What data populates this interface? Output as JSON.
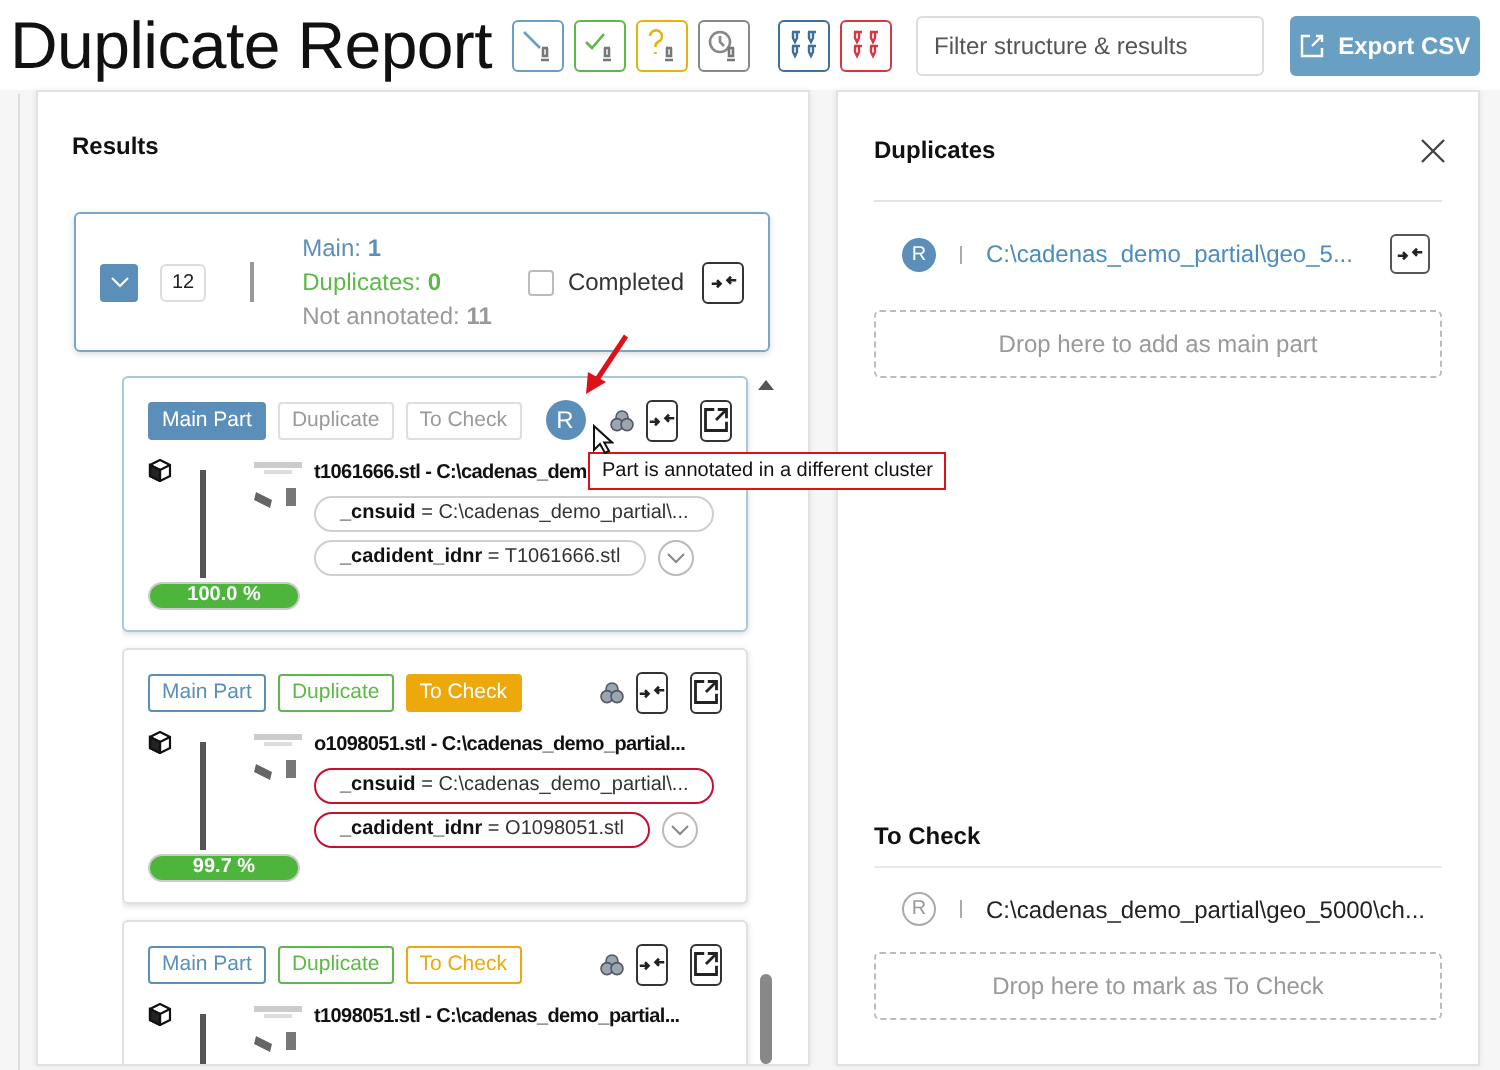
{
  "header": {
    "title": "Duplicate Report",
    "search": {
      "placeholder": "Filter structure & results"
    },
    "export_button": "Export CSV"
  },
  "results": {
    "title": "Results",
    "group": {
      "expanded": true,
      "count": "12",
      "stats": [
        {
          "kind": "main",
          "text": "Main: **1**"
        },
        {
          "kind": "duplicates",
          "text": "Duplicates: **0**"
        },
        {
          "kind": "not_annotated",
          "text": "Not annotated: **11**"
        }
      ],
      "completed": {
        "label": "Completed",
        "checked": false
      }
    },
    "parts": [
      {
        "selected": true,
        "tags": [
          {
            "kind": "main",
            "label": "Main Part",
            "selected": true,
            "disabled": false
          },
          {
            "kind": "duplicate",
            "label": "Duplicate",
            "selected": false,
            "disabled": true
          },
          {
            "kind": "tocheck",
            "label": "To Check",
            "selected": false,
            "disabled": true
          }
        ],
        "avatar": "R",
        "title": "t1061666.stl - C:\\cadenas_dem",
        "pills": [
          {
            "text": "**_cnsuid** = C:\\cadenas_demo_partial\\...",
            "mismatch": false
          },
          {
            "text": "**_cadident_idnr** = T1061666.stl",
            "mismatch": false
          }
        ],
        "score": "100.0 %",
        "level": 1,
        "tooltip": "Part is annotated in a different cluster"
      },
      {
        "selected": false,
        "tags": [
          {
            "kind": "main",
            "label": "Main Part",
            "selected": false,
            "disabled": false
          },
          {
            "kind": "duplicate",
            "label": "Duplicate",
            "selected": false,
            "disabled": false
          },
          {
            "kind": "tocheck",
            "label": "To Check",
            "selected": true,
            "disabled": false
          }
        ],
        "title": "o1098051.stl - C:\\cadenas_demo_partial...",
        "pills": [
          {
            "text": "**_cnsuid** = C:\\cadenas_demo_partial\\...",
            "mismatch": true
          },
          {
            "text": "**_cadident_idnr** = O1098051.stl",
            "mismatch": true
          }
        ],
        "score": "99.7 %",
        "level": 0.997
      },
      {
        "selected": false,
        "tags": [
          {
            "kind": "main",
            "label": "Main Part",
            "selected": false,
            "disabled": false
          },
          {
            "kind": "duplicate",
            "label": "Duplicate",
            "selected": false,
            "disabled": false
          },
          {
            "kind": "tocheck",
            "label": "To Check",
            "selected": false,
            "disabled": false
          }
        ],
        "title": "t1098051.stl - C:\\cadenas_demo_partial..."
      }
    ]
  },
  "duplicates": {
    "title": "Duplicates",
    "items": [
      {
        "avatar": "R",
        "kind": "filled",
        "link": true,
        "mergeable": true,
        "path": "C:\\cadenas_demo_partial\\geo_5..."
      }
    ],
    "drop_hint": "Drop here to add as main part"
  },
  "to_check": {
    "title": "To Check",
    "items": [
      {
        "avatar": "R",
        "kind": "outline",
        "link": false,
        "mergeable": false,
        "path": "C:\\cadenas_demo_partial\\geo_5000\\ch..."
      }
    ],
    "drop_hint": "Drop here to mark as To Check"
  }
}
